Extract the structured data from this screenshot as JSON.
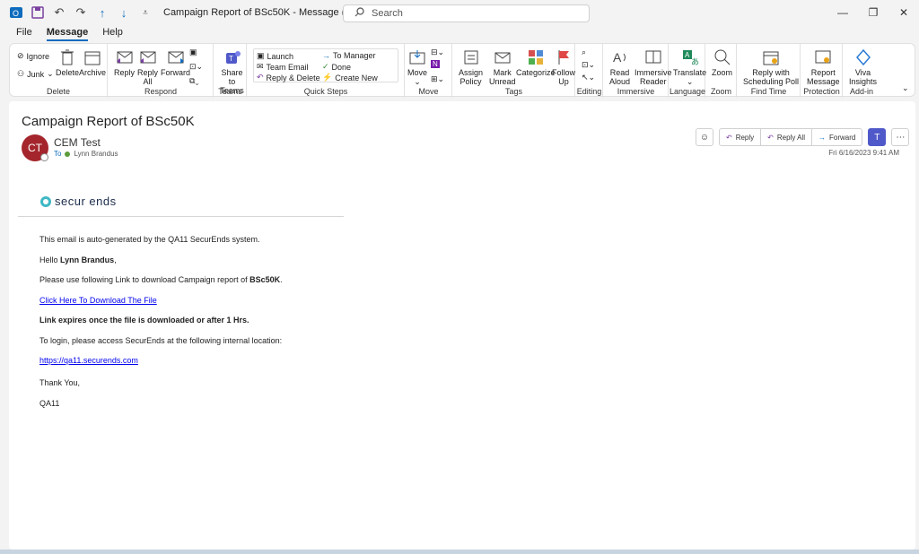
{
  "window": {
    "title": "Campaign Report of BSc50K  -  Message (HTML)",
    "search_placeholder": "Search"
  },
  "menu": [
    "File",
    "Message",
    "Help"
  ],
  "ribbon": {
    "delete_group": {
      "label": "Delete",
      "ignore": "Ignore",
      "junk": "Junk",
      "delete": "Delete",
      "archive": "Archive"
    },
    "respond_group": {
      "label": "Respond",
      "reply": "Reply",
      "reply_all_1": "Reply",
      "reply_all_2": "All",
      "forward": "Forward"
    },
    "teams_group": {
      "label": "Teams",
      "share_1": "Share to",
      "share_2": "Teams"
    },
    "quicksteps_group": {
      "label": "Quick Steps",
      "launch": "Launch",
      "team_email": "Team Email",
      "reply_delete": "Reply & Delete",
      "to_manager": "To Manager",
      "done": "Done",
      "create_new": "Create New"
    },
    "move_group": {
      "label": "Move",
      "move": "Move"
    },
    "tags_group": {
      "label": "Tags",
      "assign_1": "Assign",
      "assign_2": "Policy",
      "mark_1": "Mark",
      "mark_2": "Unread",
      "categorize": "Categorize",
      "follow_1": "Follow",
      "follow_2": "Up"
    },
    "editing_group": {
      "label": "Editing"
    },
    "immersive_group": {
      "label": "Immersive",
      "read_1": "Read",
      "read_2": "Aloud",
      "imm_1": "Immersive",
      "imm_2": "Reader"
    },
    "language_group": {
      "label": "Language",
      "translate": "Translate"
    },
    "zoom_group": {
      "label": "Zoom",
      "zoom": "Zoom"
    },
    "findtime_group": {
      "label": "Find Time",
      "poll_1": "Reply with",
      "poll_2": "Scheduling Poll"
    },
    "protection_group": {
      "label": "Protection",
      "report_1": "Report",
      "report_2": "Message"
    },
    "addin_group": {
      "label": "Add-in",
      "viva_1": "Viva",
      "viva_2": "Insights"
    }
  },
  "message": {
    "subject": "Campaign Report of BSc50K",
    "avatar_initials": "CT",
    "sender": "CEM Test",
    "to_label": "To",
    "recipient": "Lynn Brandus",
    "date": "Fri 6/16/2023 9:41 AM",
    "actions": {
      "reply": "Reply",
      "reply_all": "Reply All",
      "forward": "Forward"
    },
    "logo_text": "secur ends",
    "body": {
      "line1": "This email is auto-generated by the QA11 SecurEnds system.",
      "hello_prefix": "Hello ",
      "hello_name": "Lynn Brandus",
      "hello_suffix": ",",
      "link_intro_prefix": "Please use following Link to download Campaign report of ",
      "link_intro_bold": "BSc50K",
      "link_intro_suffix": ".",
      "download_link": "Click Here To Download The File",
      "expiry": "Link expires once the file is downloaded or after 1 Hrs.",
      "login_text": "To login, please access SecurEnds at the following internal location:",
      "login_url": "https://qa11.securends.com",
      "thanks": "Thank You,",
      "signature": "QA11"
    }
  }
}
